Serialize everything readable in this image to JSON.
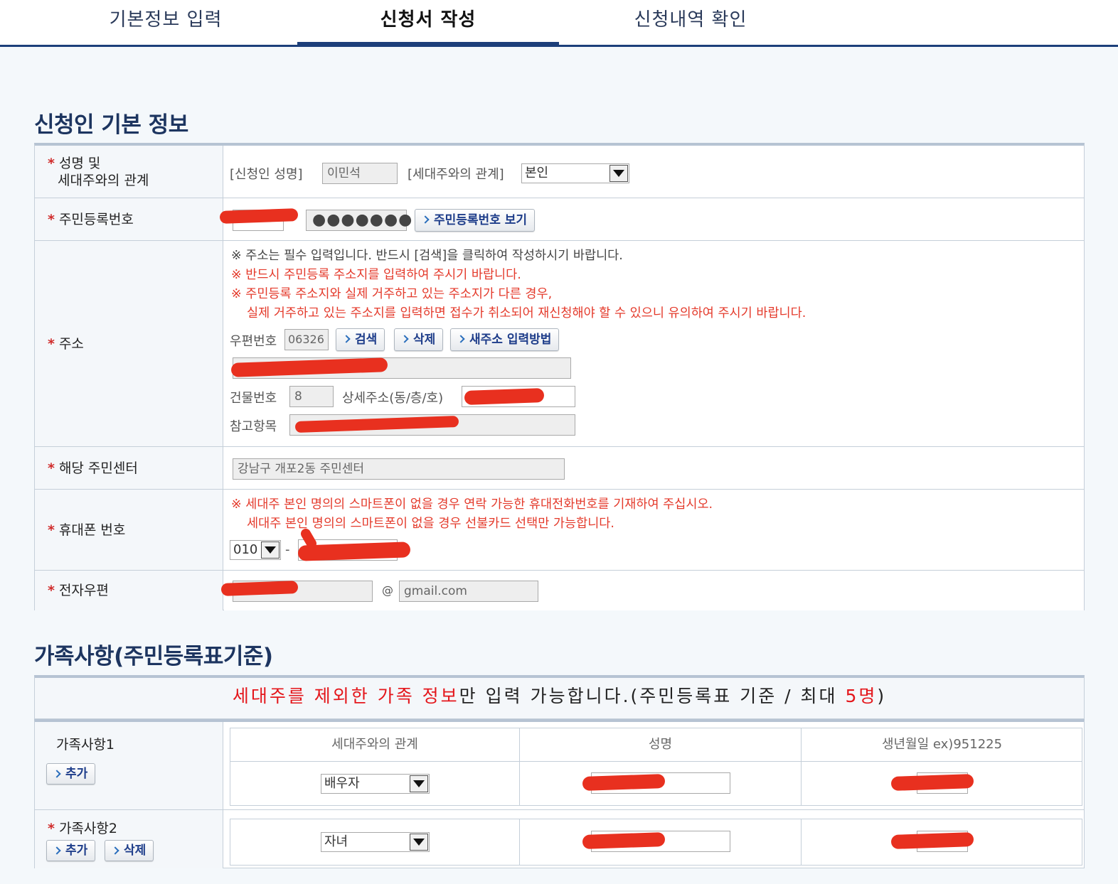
{
  "steps": [
    "기본정보 입력",
    "신청서 작성",
    "신청내역 확인"
  ],
  "section1_title": "신청인 기본 정보",
  "section2_title": "가족사항(주민등록표기준)",
  "required_mark": "*",
  "rows": {
    "name": {
      "label_line1": "성명 및",
      "label_line2": "세대주와의 관계",
      "applicant_label": "[신청인 성명]",
      "applicant_value": "이민석",
      "relation_label": "[세대주와의 관계]",
      "relation_value": "본인"
    },
    "rrn": {
      "label": "주민등록번호",
      "masked": "●●●●●●●",
      "view_button": "주민등록번호 보기"
    },
    "address": {
      "label": "주소",
      "note1": "※ 주소는 필수 입력입니다. 반드시 [검색]을 클릭하여 작성하시기 바랍니다.",
      "note2": "※ 반드시 주민등록 주소지를 입력하여 주시기 바랍니다.",
      "note3": "※ 주민등록 주소지와 실제 거주하고 있는 주소지가 다른 경우,",
      "note4": "실제 거주하고 있는 주소지를 입력하면 접수가 취소되어 재신청해야 할 수 있으니 유의하여 주시기 바랍니다.",
      "zip_label": "우편번호",
      "zip_value": "06326",
      "search_button": "검색",
      "delete_button": "삭제",
      "new_address_button": "새주소 입력방법",
      "building_label": "건물번호",
      "building_value": "8",
      "detail_label": "상세주소(동/층/호)",
      "ref_label": "참고항목"
    },
    "center": {
      "label": "해당 주민센터",
      "value": "강남구 개포2동 주민센터"
    },
    "phone": {
      "label": "휴대폰 번호",
      "note1": "※ 세대주 본인 명의의 스마트폰이 없을 경우 연락 가능한 휴대전화번호를 기재하여 주십시오.",
      "note2": "세대주 본인 명의의 스마트폰이 없을 경우 선불카드 선택만 가능합니다.",
      "prefix": "010",
      "dash": "-"
    },
    "email": {
      "label": "전자우편",
      "at": "@",
      "domain": "gmail.com"
    }
  },
  "family_notice": {
    "highlight": "세대주를 제외한 가족 정보",
    "rest": "만 입력 가능합니다.(주민등록표 기준 / 최대 ",
    "max": "5명",
    "close": ")"
  },
  "family": {
    "headers": [
      "세대주와의 관계",
      "성명",
      "생년월일 ex)951225"
    ],
    "add_button": "추가",
    "delete_button": "삭제",
    "members": [
      {
        "label": "가족사항1",
        "relation": "배우자"
      },
      {
        "label": "가족사항2",
        "relation": "자녀"
      }
    ]
  },
  "colors": {
    "accent": "#1c3f7a",
    "warning": "#e43a2b",
    "redaction": "#e8301f"
  }
}
